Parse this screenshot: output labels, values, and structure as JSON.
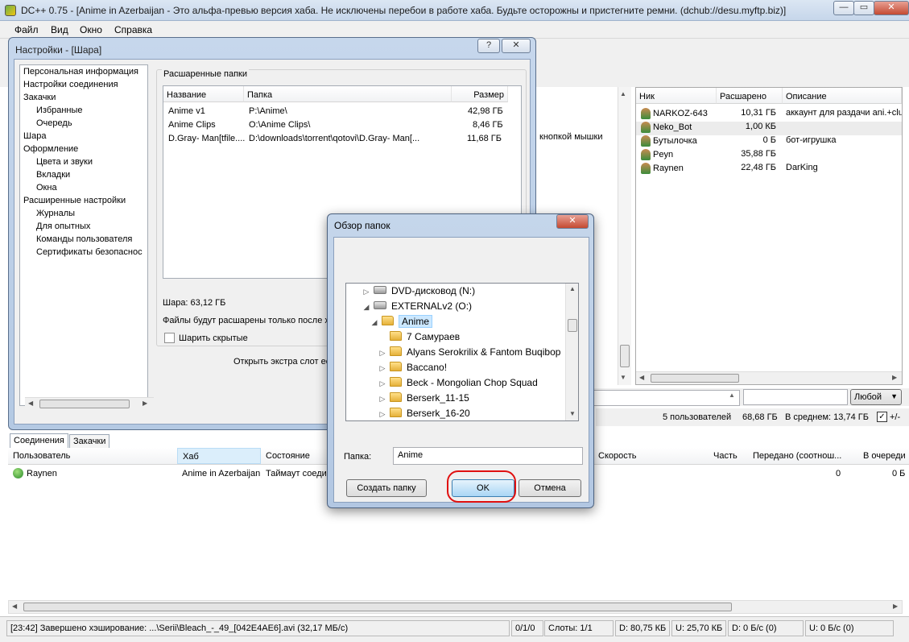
{
  "window": {
    "title": "DC++ 0.75 - [Anime in Azerbaijan - Это альфа-превью версия хаба. Не исключены перебои в работе хаба. Будьте осторожны и пристегните ремни. (dchub://desu.myftp.biz)]",
    "min": "—",
    "max": "▭",
    "close": "✕"
  },
  "menu": [
    "Файл",
    "Вид",
    "Окно",
    "Справка"
  ],
  "hub": {
    "partial_text": "кнопкой мышки"
  },
  "userlist": {
    "columns": [
      "Ник",
      "Расшарено",
      "Описание"
    ],
    "rows": [
      {
        "nick": "NARKOZ-643",
        "shared": "10,31 ГБ",
        "desc": "аккаунт для раздачи ani.+clu"
      },
      {
        "nick": "Neko_Bot",
        "shared": "1,00 КБ",
        "desc": ""
      },
      {
        "nick": "Бутылочка",
        "shared": "0 Б",
        "desc": "бот-игрушка"
      },
      {
        "nick": "Peyn",
        "shared": "35,88 ГБ",
        "desc": ""
      },
      {
        "nick": "Raynen",
        "shared": "22,48 ГБ",
        "desc": "DarKing"
      }
    ]
  },
  "search": {
    "dropdown": "Любой"
  },
  "stats": {
    "users": "5 пользователей",
    "total": "68,68 ГБ",
    "average": "В среднем: 13,74 ГБ",
    "toggle": "+/-"
  },
  "transfers": {
    "tabs": [
      "Соединения",
      "Закачки"
    ],
    "columns": [
      "Пользователь",
      "Хаб",
      "Состояние",
      "Скорость",
      "Часть",
      "Передано (соотнош...",
      "В очереди"
    ],
    "rows": [
      {
        "user": "Raynen",
        "hub": "Anime in Azerbaijan",
        "state": "Таймаут соеди",
        "part": "0",
        "queued": "0 Б"
      }
    ]
  },
  "statusbar": {
    "log": "[23:42] Завершено хэширование: ...\\Serii\\Bleach_-_49_[042E4AE6].avi (32,17 МБ/с)",
    "counts": "0/1/0",
    "slots": "Слоты: 1/1",
    "dl": "D: 80,75 КБ",
    "ul": "U: 25,70 КБ",
    "dl_rate": "D: 0 Б/с (0)",
    "ul_rate": "U: 0 Б/с (0)"
  },
  "settings": {
    "title": "Настройки - [Шара]",
    "help": "?",
    "close": "✕",
    "nav": [
      {
        "label": "Персональная информация",
        "level": 0
      },
      {
        "label": "Настройки соединения",
        "level": 0
      },
      {
        "label": "Закачки",
        "level": 0
      },
      {
        "label": "Избранные",
        "level": 1
      },
      {
        "label": "Очередь",
        "level": 1
      },
      {
        "label": "Шара",
        "level": 0
      },
      {
        "label": "Оформление",
        "level": 0
      },
      {
        "label": "Цвета и звуки",
        "level": 1
      },
      {
        "label": "Вкладки",
        "level": 1
      },
      {
        "label": "Окна",
        "level": 1
      },
      {
        "label": "Расширенные настройки",
        "level": 0
      },
      {
        "label": "Журналы",
        "level": 1
      },
      {
        "label": "Для опытных",
        "level": 1
      },
      {
        "label": "Команды пользователя",
        "level": 1
      },
      {
        "label": "Сертификаты безопаснос",
        "level": 1
      }
    ],
    "group_label": "Расшаренные папки",
    "columns": [
      "Название",
      "Папка",
      "Размер"
    ],
    "folders": [
      {
        "name": "Anime v1",
        "path": "P:\\Anime\\",
        "size": "42,98 ГБ"
      },
      {
        "name": "Anime Clips",
        "path": "O:\\Anime Clips\\",
        "size": "8,46 ГБ"
      },
      {
        "name": "D.Gray- Man[tfile....",
        "path": "D:\\downloads\\torrent\\qotovi\\D.Gray- Man[...",
        "size": "11,68 ГБ"
      }
    ],
    "share_total": "Шара: 63,12 ГБ",
    "note": "Файлы будут расшарены только после хэ",
    "hidden_checkbox": "Шарить скрытые",
    "extra_slot": "Открыть экстра слот ес"
  },
  "browse": {
    "title": "Обзор папок",
    "close": "✕",
    "tree": [
      {
        "label": "DVD-дисковод (N:)",
        "type": "drive",
        "indent": 0,
        "expander": "▷"
      },
      {
        "label": "EXTERNALv2 (O:)",
        "type": "drive",
        "indent": 0,
        "expander": "◢"
      },
      {
        "label": "Anime",
        "type": "folder",
        "indent": 1,
        "expander": "◢",
        "selected": true
      },
      {
        "label": "7 Самураев",
        "type": "folder",
        "indent": 2,
        "expander": ""
      },
      {
        "label": "Alyans Serokrilix & Fantom Buqibop",
        "type": "folder",
        "indent": 2,
        "expander": "▷"
      },
      {
        "label": "Baccano!",
        "type": "folder",
        "indent": 2,
        "expander": "▷"
      },
      {
        "label": "Beck - Mongolian Chop Squad",
        "type": "folder",
        "indent": 2,
        "expander": "▷"
      },
      {
        "label": "Berserk_11-15",
        "type": "folder",
        "indent": 2,
        "expander": "▷"
      },
      {
        "label": "Berserk_16-20",
        "type": "folder",
        "indent": 2,
        "expander": "▷"
      }
    ],
    "folder_label": "Папка:",
    "folder_value": "Anime",
    "create_button": "Создать папку",
    "ok_button": "OK",
    "cancel_button": "Отмена"
  }
}
